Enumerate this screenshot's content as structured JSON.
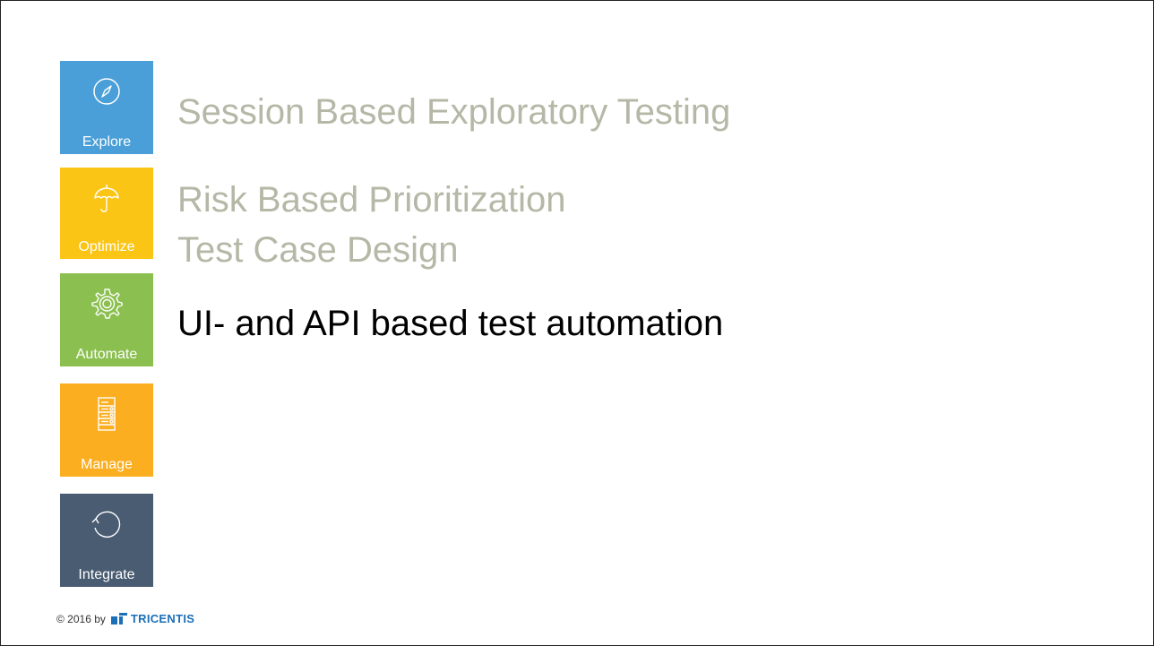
{
  "colors": {
    "explore": "#4a9fd8",
    "optimize": "#fbc515",
    "automate": "#8bbf4f",
    "manage": "#faae20",
    "integrate": "#495c72",
    "muted_text": "#b5b8a6",
    "active_text": "#000000",
    "brand": "#1a6fb8"
  },
  "sidebar": {
    "tiles": [
      {
        "label": "Explore",
        "icon": "compass-icon"
      },
      {
        "label": "Optimize",
        "icon": "umbrella-icon"
      },
      {
        "label": "Automate",
        "icon": "gear-icon"
      },
      {
        "label": "Manage",
        "icon": "server-list-icon"
      },
      {
        "label": "Integrate",
        "icon": "cycle-arrow-icon"
      }
    ]
  },
  "content": {
    "lines": [
      {
        "text": "Session Based Exploratory Testing",
        "active": false
      },
      {
        "text": "Risk Based Prioritization",
        "active": false
      },
      {
        "text": "Test Case Design",
        "active": false
      },
      {
        "text": "UI- and API based test automation",
        "active": true
      }
    ]
  },
  "footer": {
    "copyright": "© 2016 by",
    "brand": "TRICENTIS"
  }
}
